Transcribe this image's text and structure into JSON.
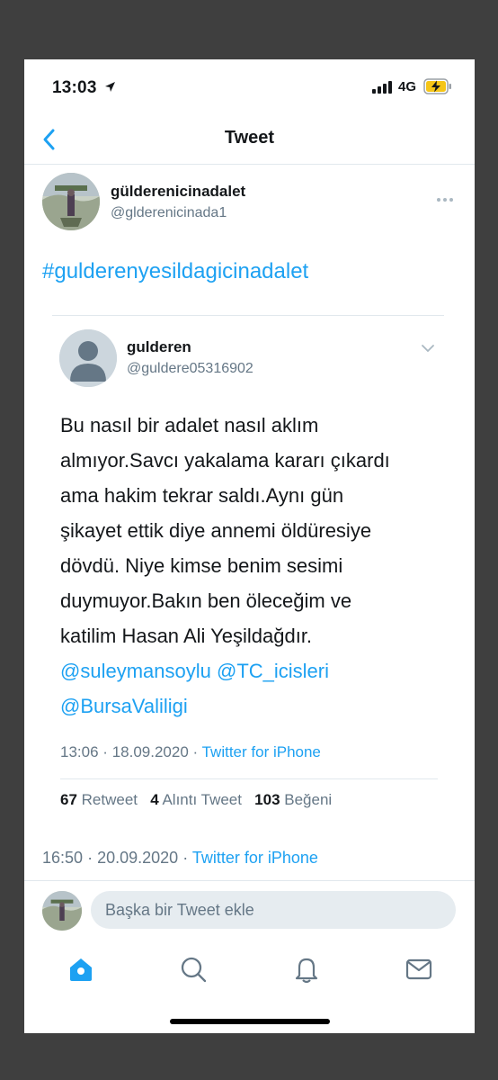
{
  "status_bar": {
    "time": "13:03",
    "network": "4G"
  },
  "nav": {
    "title": "Tweet"
  },
  "tweet": {
    "author_name": "gülderenicinadalet",
    "author_handle": "@glderenicinada1",
    "text": "#gulderenyesildagicinadalet",
    "time": "16:50",
    "date": "20.09.2020",
    "source": "Twitter for iPhone"
  },
  "quoted_tweet": {
    "author_name": "gulderen",
    "author_handle": "@guldere05316902",
    "text_lines": [
      "Bu nasıl bir adalet nasıl aklım",
      "almıyor.Savcı yakalama kararı çıkardı",
      "ama hakim tekrar saldı.Aynı gün",
      "şikayet ettik diye annemi öldüresiye",
      "dövdü. Niye kimse benim sesimi",
      "duymuyor.Bakın ben öleceğim ve",
      "katilim Hasan Ali Yeşildağdır."
    ],
    "mention_1": "@suleymansoylu",
    "mention_2": "@TC_icisleri",
    "mention_3": "@BursaValiligi",
    "time": "13:06",
    "date": "18.09.2020",
    "source": "Twitter for iPhone",
    "retweets": "67",
    "retweets_label": "Retweet",
    "quotes": "4",
    "quotes_label": "Alıntı Tweet",
    "likes": "103",
    "likes_label": "Beğeni"
  },
  "reply": {
    "placeholder": "Başka bir Tweet ekle"
  },
  "tab_bar": {
    "items": [
      "home-icon",
      "search-icon",
      "notifications-icon",
      "messages-icon"
    ],
    "active": "home-icon"
  },
  "colors": {
    "accent": "#1da1f2",
    "secondary_text": "#657786",
    "border": "#e1e8ed",
    "battery": "#f5c518"
  }
}
